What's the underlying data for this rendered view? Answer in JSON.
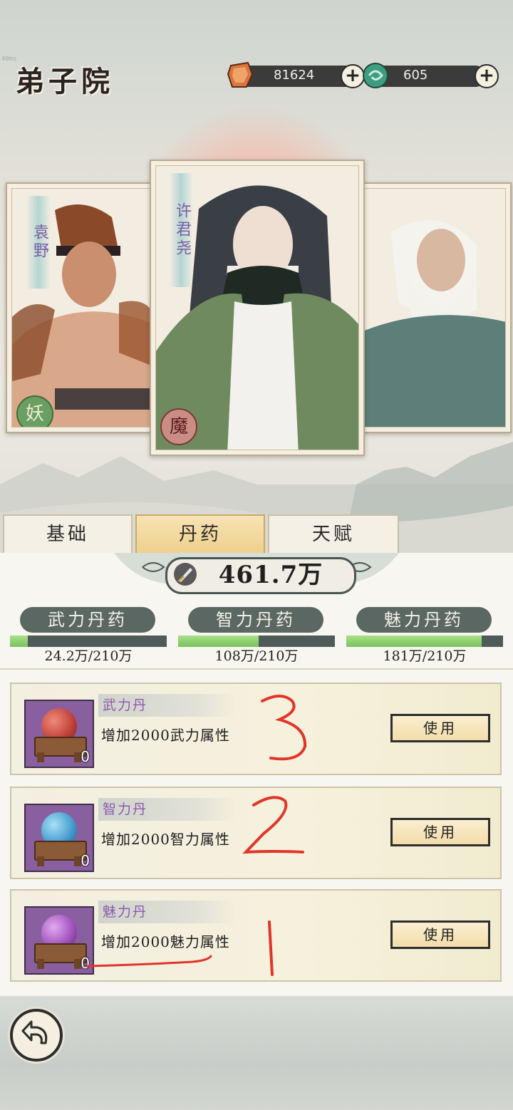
{
  "header": {
    "fps": "40ms",
    "title": "弟子院",
    "currency_copper": "81624",
    "currency_jade": "605"
  },
  "cards": [
    {
      "name": "袁野",
      "seal": "妖"
    },
    {
      "name": "许君尧",
      "seal": "魔"
    },
    {
      "name": "",
      "seal": ""
    }
  ],
  "tabs": [
    {
      "label": "基础",
      "active": false
    },
    {
      "label": "丹药",
      "active": true
    },
    {
      "label": "天赋",
      "active": false
    }
  ],
  "power": "461.7万",
  "stats": [
    {
      "label": "武力丹药",
      "value": "24.2万/210万",
      "fraction": 0.115
    },
    {
      "label": "智力丹药",
      "value": "108万/210万",
      "fraction": 0.514
    },
    {
      "label": "魅力丹药",
      "value": "181万/210万",
      "fraction": 0.862
    }
  ],
  "items": [
    {
      "name": "武力丹",
      "desc": "增加2000武力属性",
      "count": "0",
      "orb_color": "#c2453c",
      "button": "使用",
      "annotation": "3"
    },
    {
      "name": "智力丹",
      "desc": "增加2000智力属性",
      "count": "0",
      "orb_color": "#4a9fd0",
      "button": "使用",
      "annotation": "2"
    },
    {
      "name": "魅力丹",
      "desc": "增加2000魅力属性",
      "count": "0",
      "orb_color": "#a457c0",
      "button": "使用",
      "annotation": "1"
    }
  ],
  "colors": {
    "accent_purple": "#8a5ab0",
    "annotation_red": "#e2352a",
    "bar_green": "#8dd06a"
  }
}
